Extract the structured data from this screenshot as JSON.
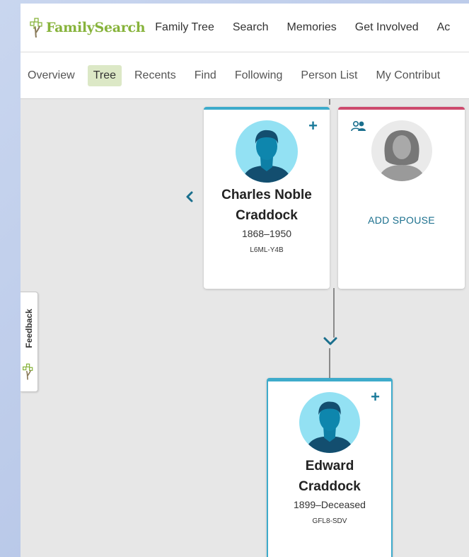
{
  "header": {
    "logo_text": "FamilySearch",
    "nav": [
      "Family Tree",
      "Search",
      "Memories",
      "Get Involved",
      "Ac"
    ]
  },
  "subnav": {
    "items": [
      "Overview",
      "Tree",
      "Recents",
      "Find",
      "Following",
      "Person List",
      "My Contribut"
    ],
    "active_index": 1
  },
  "tree": {
    "father": {
      "name_line1": "Charles Noble",
      "name_line2": "Craddock",
      "dates": "1868–1950",
      "id": "L6ML-Y4B"
    },
    "spouse_slot": {
      "label": "ADD SPOUSE"
    },
    "child": {
      "name_line1": "Edward",
      "name_line2": "Craddock",
      "dates": "1899–Deceased",
      "id": "GFL8-SDV"
    }
  },
  "feedback": {
    "label": "Feedback"
  },
  "colors": {
    "brand_green": "#87b33b",
    "male": "#3eabcb",
    "female": "#cd4b6e",
    "link": "#1a6f8d"
  }
}
